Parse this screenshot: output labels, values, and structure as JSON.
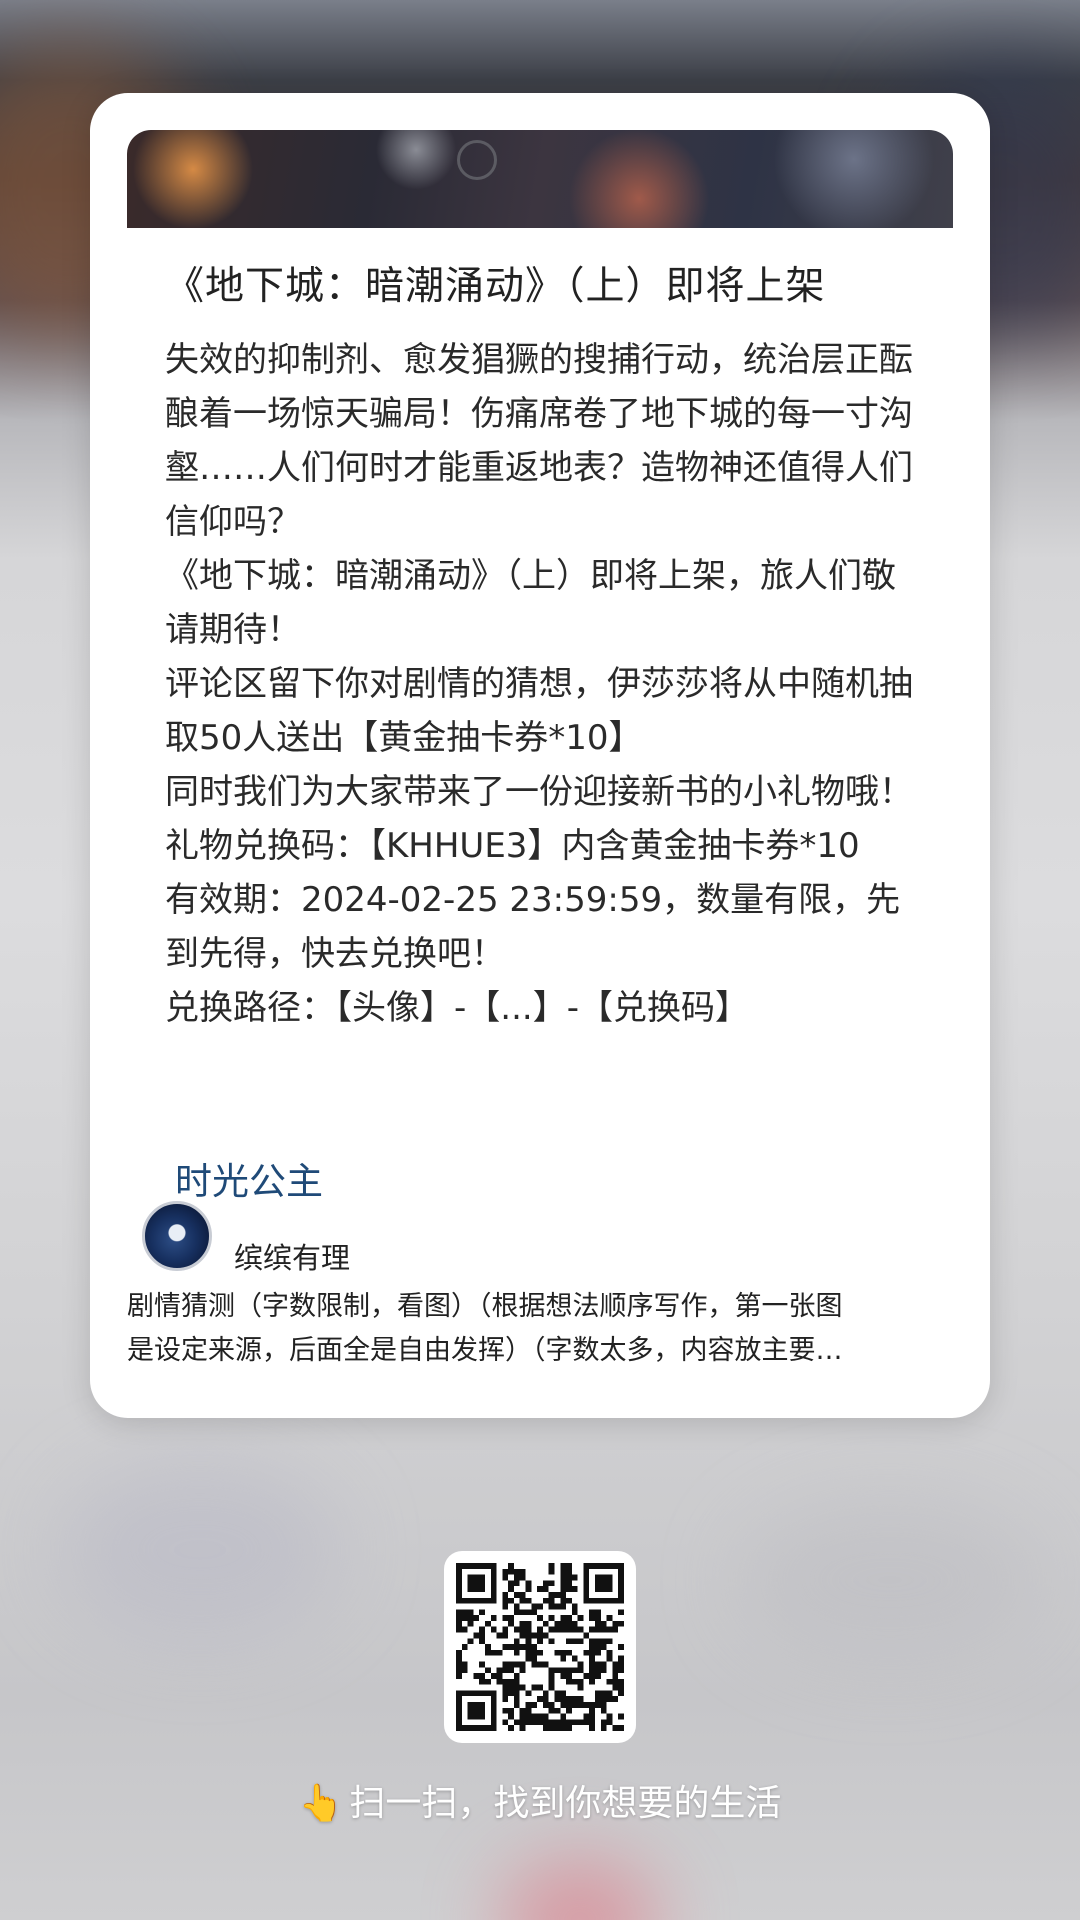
{
  "post": {
    "title": "《地下城：暗潮涌动》（上）即将上架",
    "paragraphs": [
      "失效的抑制剂、愈发猖獗的搜捕行动，统治层正酝酿着一场惊天骗局！伤痛席卷了地下城的每一寸沟壑……人们何时才能重返地表？造物神还值得人们信仰吗？",
      "《地下城：暗潮涌动》（上）即将上架，旅人们敬请期待！",
      "评论区留下你对剧情的猜想，伊莎莎将从中随机抽取50人送出【黄金抽卡券*10】",
      "同时我们为大家带来了一份迎接新书的小礼物哦！",
      "礼物兑换码：【KHHUE3】内含黄金抽卡券*10",
      "有效期：2024-02-25 23:59:59，数量有限，先到先得，快去兑换吧！",
      "兑换路径：【头像】-【...】-【兑换码】"
    ],
    "author": "时光公主"
  },
  "comment": {
    "user": "缤缤有理",
    "line1": "剧情猜测（字数限制，看图）（根据想法顺序写作，第一张图",
    "line2": "是设定来源，后面全是自由发挥）（字数太多，内容放主要…"
  },
  "footer": {
    "hand_icon": "pointing-hand-icon",
    "scan_text": "扫一扫，找到你想要的生活"
  }
}
